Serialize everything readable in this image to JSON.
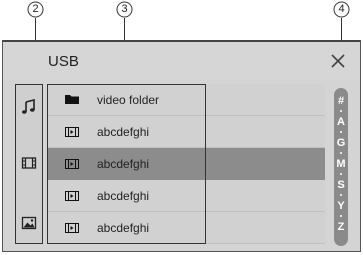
{
  "callouts": [
    "2",
    "3",
    "4"
  ],
  "header": {
    "title": "USB"
  },
  "mode_bar": {
    "icons": [
      "music-note-icon",
      "film-strip-icon",
      "photo-icon"
    ]
  },
  "file_list": {
    "items": [
      {
        "label": "video folder",
        "icon": "folder-icon"
      },
      {
        "label": "abcdefghi",
        "icon": "video-file-icon"
      },
      {
        "label": "abcdefghi",
        "icon": "video-file-icon",
        "selected": true
      },
      {
        "label": "abcdefghi",
        "icon": "video-file-icon"
      },
      {
        "label": "abcdefghi",
        "icon": "video-file-icon"
      }
    ]
  },
  "alpha_bar": {
    "letters": [
      "#",
      "A",
      "G",
      "M",
      "S",
      "Y",
      "Z"
    ]
  },
  "colors": {
    "background": "#d4d4d4",
    "selected_row": "#8c8c8c",
    "alpha_bar": "#8a8a8a"
  }
}
